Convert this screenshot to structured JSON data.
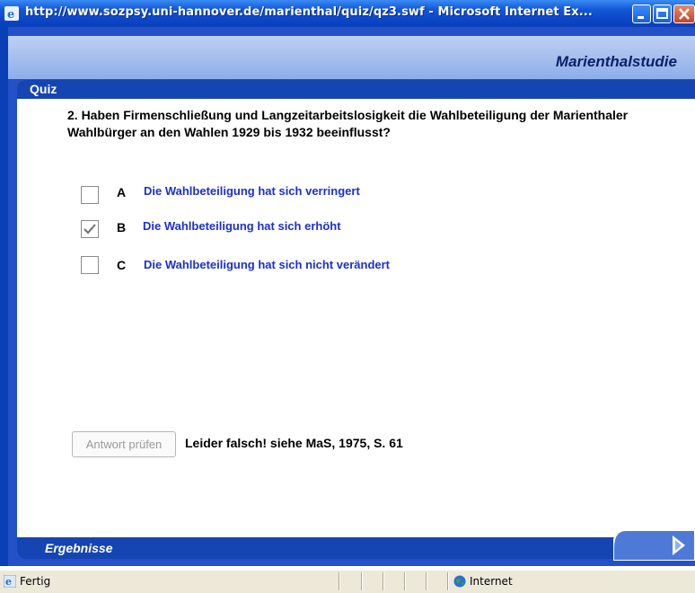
{
  "window": {
    "title": "http://www.sozpsy.uni-hannover.de/marienthal/quiz/qz3.swf - Microsoft Internet Ex...",
    "icon": "ie-icon",
    "buttons": [
      "minimize-icon",
      "maximize-icon",
      "close-icon"
    ]
  },
  "app": {
    "brand": "Marienthalstudie",
    "section_label": "Quiz",
    "footer_label": "Ergebnisse",
    "next_icon": "chevron-right-icon"
  },
  "quiz": {
    "question": "2. Haben Firmenschließung und Langzeitarbeitslosigkeit die Wahlbeteiligung der Marienthaler Wahlbürger an den Wahlen 1929 bis 1932 beeinflusst?",
    "options": [
      {
        "letter": "A",
        "text": "Die Wahlbeteiligung hat sich verringert",
        "checked": false
      },
      {
        "letter": "B",
        "text": "Die Wahlbeteiligung hat sich erhöht",
        "checked": true
      },
      {
        "letter": "C",
        "text": "Die Wahlbeteiligung hat sich nicht verändert",
        "checked": false
      }
    ],
    "check_button": "Antwort prüfen",
    "feedback": "Leider falsch! siehe MaS, 1975, S. 61"
  },
  "statusbar": {
    "status": "Fertig",
    "zone": "Internet"
  },
  "colors": {
    "title_bar": "#0b47c9",
    "panel_bar": "#1544b3",
    "option_text": "#1a2fd6",
    "brand_text": "#0b1f6a"
  }
}
